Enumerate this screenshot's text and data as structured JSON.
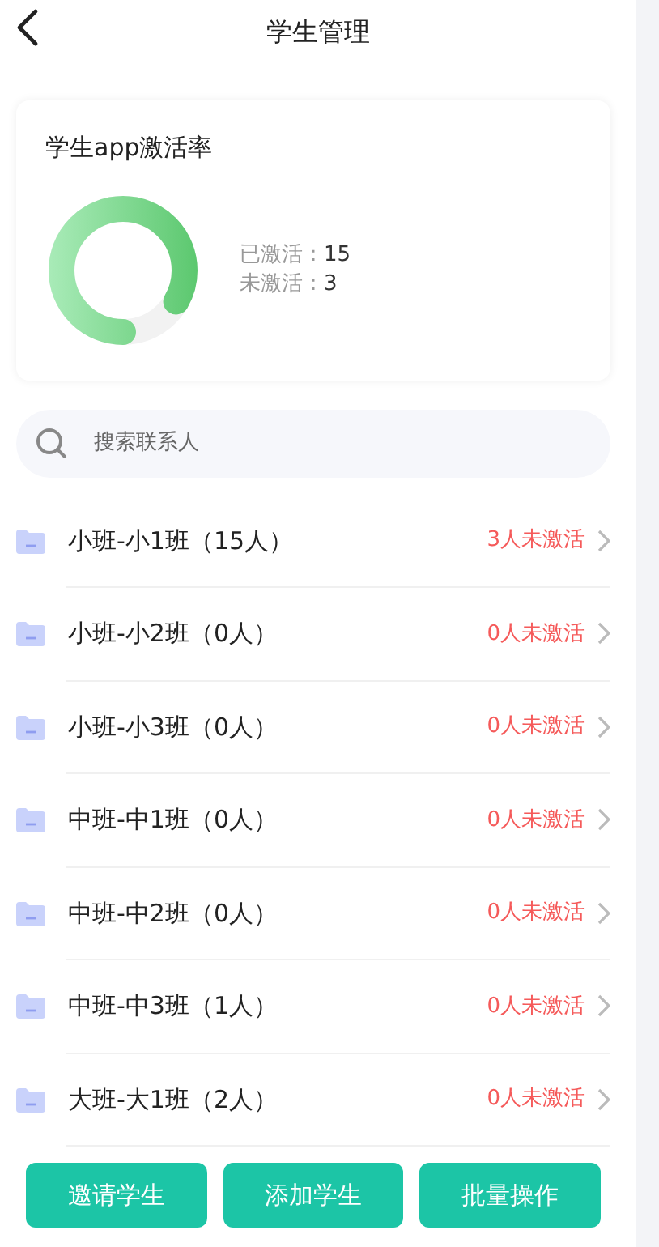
{
  "header": {
    "title": "学生管理"
  },
  "activation": {
    "title": "学生app激活率",
    "stats": [
      {
        "label": "已激活：",
        "value": "15"
      },
      {
        "label": "未激活：",
        "value": "3"
      }
    ]
  },
  "search": {
    "placeholder": "搜索联系人"
  },
  "classes": [
    {
      "name": "小班-小1班（15人）",
      "inactive": "3人未激活"
    },
    {
      "name": "小班-小2班（0人）",
      "inactive": "0人未激活"
    },
    {
      "name": "小班-小3班（0人）",
      "inactive": "0人未激活"
    },
    {
      "name": "中班-中1班（0人）",
      "inactive": "0人未激活"
    },
    {
      "name": "中班-中2班（0人）",
      "inactive": "0人未激活"
    },
    {
      "name": "中班-中3班（1人）",
      "inactive": "0人未激活"
    },
    {
      "name": "大班-大1班（2人）",
      "inactive": "0人未激活"
    }
  ],
  "buttons": [
    "邀请学生",
    "添加学生",
    "批量操作"
  ]
}
